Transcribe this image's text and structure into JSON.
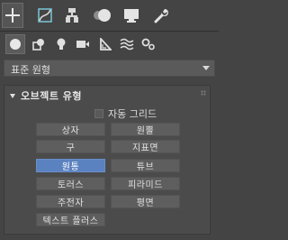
{
  "tabs": [
    {
      "name": "create-tab-icon",
      "active": true
    },
    {
      "name": "modify-tab-icon",
      "active": false
    },
    {
      "name": "hierarchy-tab-icon",
      "active": false
    },
    {
      "name": "motion-tab-icon",
      "active": false
    },
    {
      "name": "display-tab-icon",
      "active": false
    },
    {
      "name": "utilities-tab-icon",
      "active": false
    }
  ],
  "categories": [
    {
      "name": "geometry-icon",
      "active": true
    },
    {
      "name": "shapes-icon",
      "active": false
    },
    {
      "name": "lights-icon",
      "active": false
    },
    {
      "name": "cameras-icon",
      "active": false
    },
    {
      "name": "helpers-icon",
      "active": false
    },
    {
      "name": "space-warps-icon",
      "active": false
    },
    {
      "name": "systems-icon",
      "active": false
    }
  ],
  "dropdown": {
    "value": "표준 원형"
  },
  "rollout": {
    "title": "오브젝트 유형",
    "autogrid_label": "자동 그리드",
    "autogrid_checked": false,
    "buttons": [
      "상자",
      "원뿔",
      "구",
      "지표면",
      "원통",
      "튜브",
      "토러스",
      "피라미드",
      "주전자",
      "평면",
      "텍스트 플러스"
    ],
    "active_button": "원통"
  },
  "colors": {
    "accent": "#5b82c0",
    "background": "#444444",
    "button": "#5e5e5e"
  }
}
